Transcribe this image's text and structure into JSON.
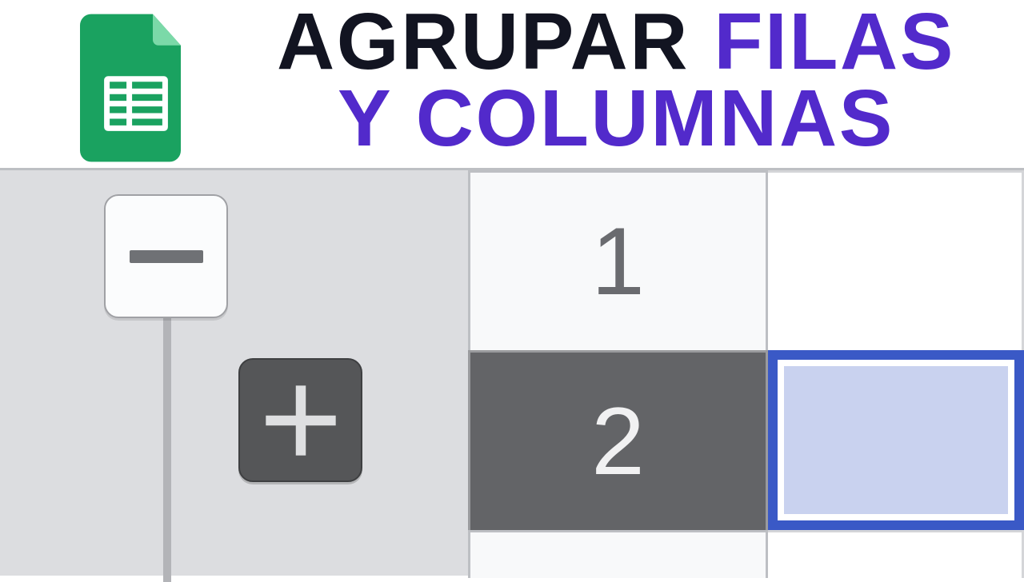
{
  "banner": {
    "icon_name": "google-sheets-icon",
    "line1_a": "AGRUPAR ",
    "line1_b": "FILAS",
    "line2": "Y COLUMNAS"
  },
  "sheet": {
    "collapse_label": "-",
    "expand_label": "+",
    "rows": {
      "r1": "1",
      "r2": "2",
      "r3": ""
    },
    "selected_row": 2
  },
  "colors": {
    "accent": "#522acb",
    "sheets_green": "#1aa260",
    "selected_row_header_bg": "#636467",
    "selection_border": "#3a59c6",
    "selection_fill": "#c9d2ef"
  }
}
